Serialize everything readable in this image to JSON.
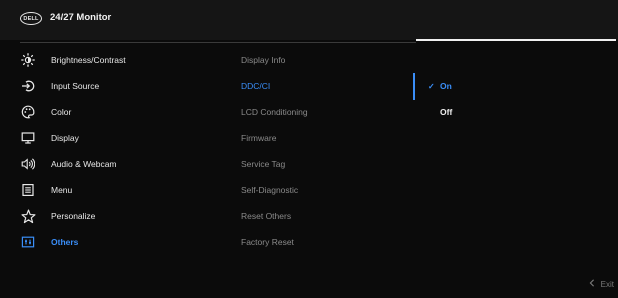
{
  "header": {
    "logo_text": "DELL",
    "title": "24/27 Monitor"
  },
  "menu": {
    "items": [
      {
        "label": "Brightness/Contrast",
        "icon": "brightness-icon"
      },
      {
        "label": "Input Source",
        "icon": "input-source-icon"
      },
      {
        "label": "Color",
        "icon": "color-icon"
      },
      {
        "label": "Display",
        "icon": "display-icon"
      },
      {
        "label": "Audio & Webcam",
        "icon": "speaker-icon"
      },
      {
        "label": "Menu",
        "icon": "menu-icon"
      },
      {
        "label": "Personalize",
        "icon": "star-icon"
      },
      {
        "label": "Others",
        "icon": "others-icon",
        "active": true
      }
    ]
  },
  "submenu": {
    "items": [
      {
        "label": "Display Info"
      },
      {
        "label": "DDC/CI",
        "active": true
      },
      {
        "label": "LCD Conditioning"
      },
      {
        "label": "Firmware"
      },
      {
        "label": "Service Tag"
      },
      {
        "label": "Self-Diagnostic"
      },
      {
        "label": "Reset Others"
      },
      {
        "label": "Factory Reset"
      }
    ]
  },
  "options": {
    "items": [
      {
        "label": "On",
        "selected": true
      },
      {
        "label": "Off",
        "selected": false
      }
    ],
    "check_glyph": "✓"
  },
  "footer": {
    "exit_label": "Exit",
    "exit_icon": "chevron-left-icon"
  },
  "colors": {
    "accent": "#3a8ef8",
    "background": "#0b0b0b",
    "header": "#151515"
  }
}
